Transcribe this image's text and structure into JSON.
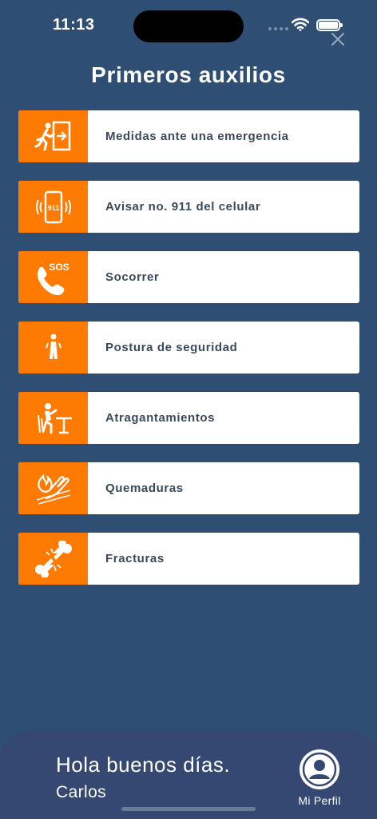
{
  "status_bar": {
    "time": "11:13",
    "icons": [
      "signal-icon",
      "wifi-icon",
      "battery-icon"
    ]
  },
  "header": {
    "title": "Primeros auxilios",
    "close_icon": "close-icon"
  },
  "menu": {
    "items": [
      {
        "label": "Medidas ante una emergencia",
        "icon": "emergency-exit-icon"
      },
      {
        "label": "Avisar no. 911 del celular",
        "icon": "phone-911-icon",
        "icon_text": "911"
      },
      {
        "label": "Socorrer",
        "icon": "sos-phone-icon",
        "icon_text": "SOS"
      },
      {
        "label": "Postura de seguridad",
        "icon": "body-posture-icon"
      },
      {
        "label": "Atragantamientos",
        "icon": "choking-person-icon"
      },
      {
        "label": "Quemaduras",
        "icon": "burn-hand-icon"
      },
      {
        "label": "Fracturas",
        "icon": "broken-bone-icon"
      }
    ]
  },
  "footer": {
    "greeting": "Hola buenos días.",
    "user_name": "Carlos",
    "profile_label": "Mi Perfil",
    "profile_icon": "user-avatar-icon"
  },
  "colors": {
    "background": "#2f4e74",
    "accent": "#ff7a00",
    "card": "#ffffff",
    "panel": "#344872"
  }
}
